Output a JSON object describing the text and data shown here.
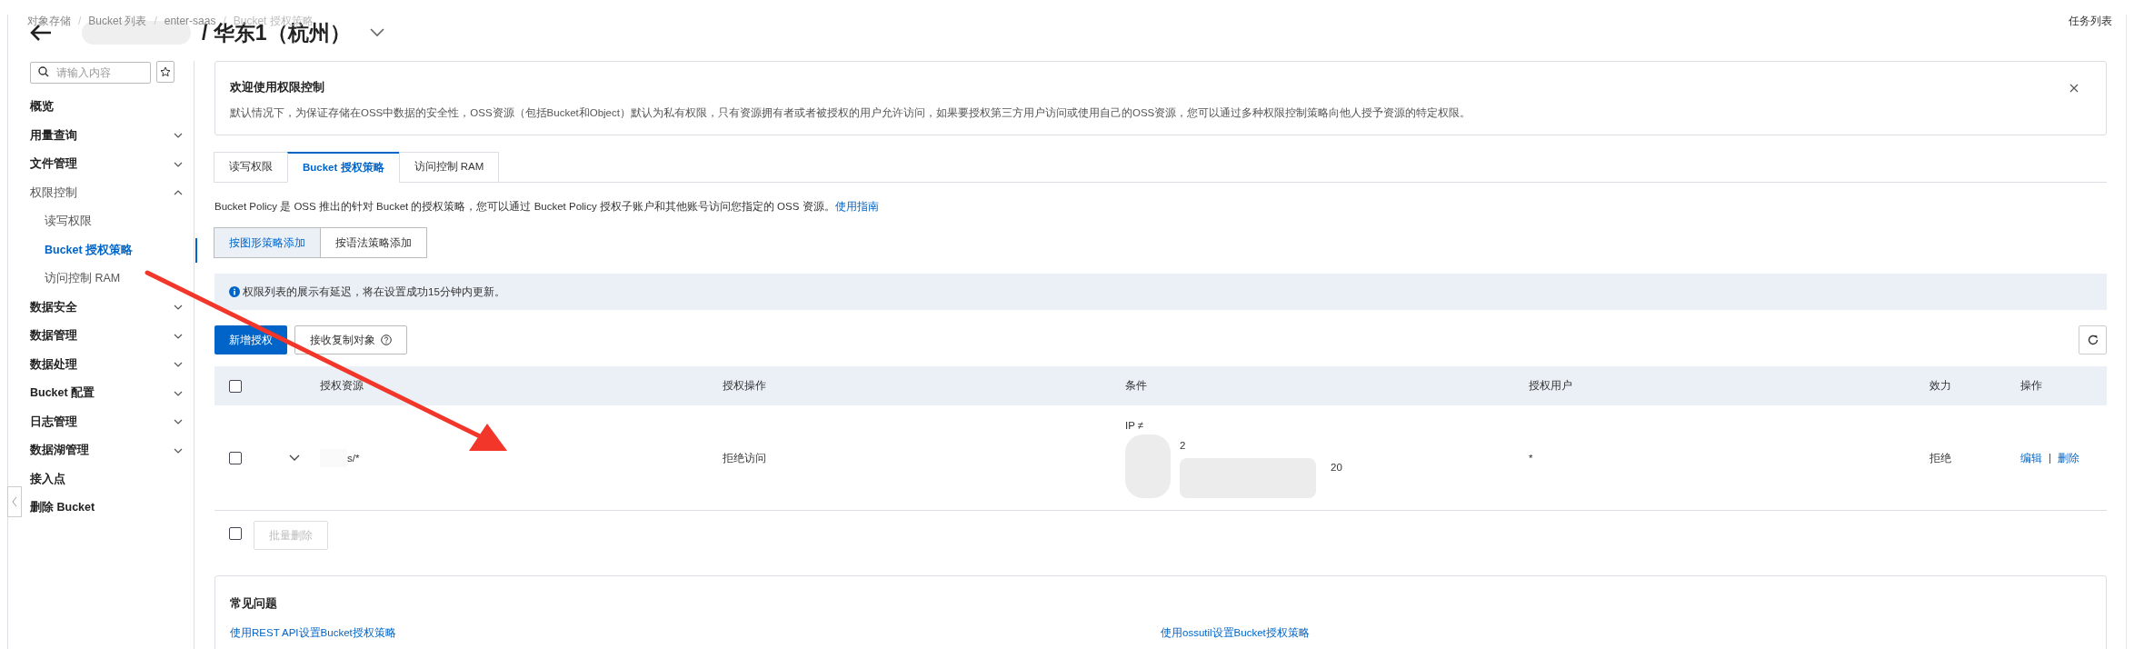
{
  "breadcrumb": [
    "对象存储",
    "/",
    "Bucket 列表",
    "/",
    "enter-saas",
    "/",
    "Bucket 授权策略"
  ],
  "task_list": "任务列表",
  "title": "/ 华东1（杭州）",
  "sidebar": {
    "search": {
      "placeholder": "请输入内容"
    },
    "items": [
      {
        "label": "概览",
        "kind": "link",
        "selected": false
      },
      {
        "label": "用量查询",
        "kind": "group",
        "expanded": false,
        "selected": false
      },
      {
        "label": "文件管理",
        "kind": "group",
        "expanded": false,
        "selected": false
      },
      {
        "label": "权限控制",
        "kind": "group",
        "expanded": true,
        "selected": false,
        "children": [
          {
            "label": "读写权限",
            "kind": "link",
            "selected": false
          },
          {
            "label": "Bucket 授权策略",
            "kind": "link",
            "selected": true
          },
          {
            "label": "访问控制 RAM",
            "kind": "link",
            "selected": false
          }
        ]
      },
      {
        "label": "数据安全",
        "kind": "group",
        "expanded": false,
        "selected": false
      },
      {
        "label": "数据管理",
        "kind": "group",
        "expanded": false,
        "selected": false
      },
      {
        "label": "数据处理",
        "kind": "group",
        "expanded": false,
        "selected": false
      },
      {
        "label": "Bucket 配置",
        "kind": "group",
        "expanded": false,
        "selected": false
      },
      {
        "label": "日志管理",
        "kind": "group",
        "expanded": false,
        "selected": false
      },
      {
        "label": "数据湖管理",
        "kind": "group",
        "expanded": false,
        "selected": false
      },
      {
        "label": "接入点",
        "kind": "link",
        "selected": false
      },
      {
        "label": "删除 Bucket",
        "kind": "link",
        "selected": false
      }
    ]
  },
  "banner": {
    "title": "欢迎使用权限控制",
    "text": "默认情况下，为保证存储在OSS中数据的安全性，OSS资源（包括Bucket和Object）默认为私有权限，只有资源拥有者或者被授权的用户允许访问，如果要授权第三方用户访问或使用自己的OSS资源，您可以通过多种权限控制策略向他人授予资源的特定权限。"
  },
  "tabs": [
    {
      "label": "读写权限",
      "selected": false
    },
    {
      "label": "Bucket 授权策略",
      "selected": true
    },
    {
      "label": "访问控制 RAM",
      "selected": false
    }
  ],
  "description": {
    "text": "Bucket Policy 是 OSS 推出的针对 Bucket 的授权策略，您可以通过 Bucket Policy 授权子账户和其他账号访问您指定的 OSS 资源。",
    "link": "使用指南"
  },
  "mode_buttons": [
    {
      "label": "按图形策略添加",
      "selected": true
    },
    {
      "label": "按语法策略添加",
      "selected": false
    }
  ],
  "notice": "权限列表的展示有延迟，将在设置成功15分钟内更新。",
  "actions": [
    {
      "label": "新增授权",
      "kind": "primary"
    },
    {
      "label": "接收复制对象",
      "kind": "help"
    }
  ],
  "table": {
    "header_checked": false,
    "columns": [
      "授权资源",
      "授权操作",
      "条件",
      "授权用户",
      "效力",
      "操作"
    ],
    "rows": [
      {
        "checked": false,
        "expanded": false,
        "resource": "s/*",
        "action": "拒绝访问",
        "condition": [
          "IP ≠",
          "2",
          "20"
        ],
        "user": "*",
        "effect": "拒绝",
        "operations": [
          "编辑",
          "删除"
        ]
      }
    ]
  },
  "bulk": {
    "checked": false,
    "button": "批量删除",
    "disabled": true
  },
  "faq": {
    "title": "常见问题",
    "links": [
      "使用REST API设置Bucket授权策略",
      "使用ossutil设置Bucket授权策略"
    ]
  }
}
